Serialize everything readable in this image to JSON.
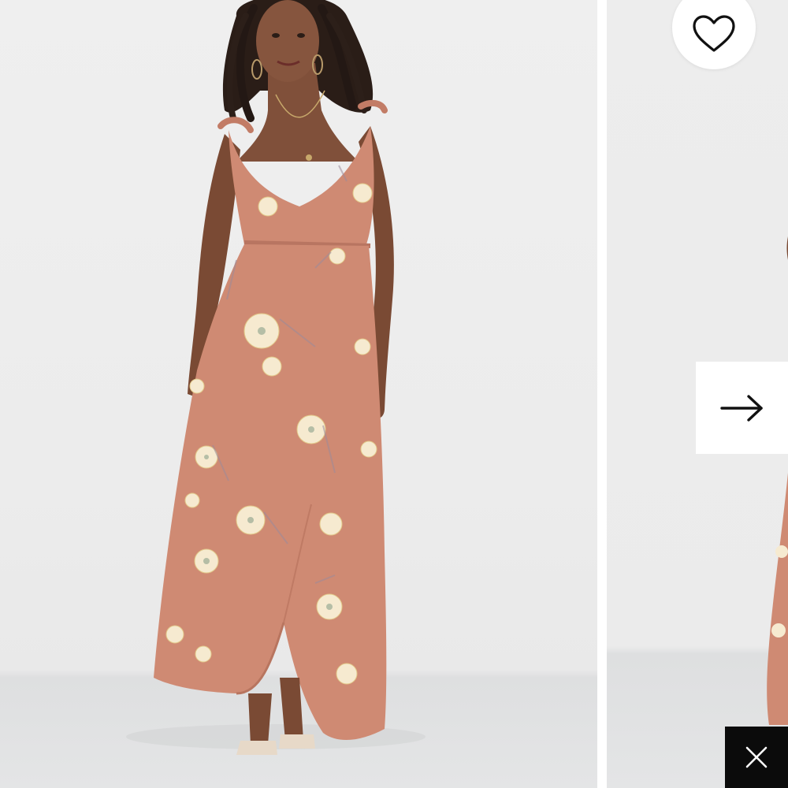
{
  "gallery": {
    "main_image": {
      "icon": "product-photo",
      "subject": "model-in-floral-wrap-maxi-dress"
    },
    "next_image": {
      "icon": "product-photo-partial"
    }
  },
  "controls": {
    "favorite": {
      "icon": "heart-outline-icon"
    },
    "next": {
      "icon": "arrow-right-icon"
    },
    "close": {
      "icon": "close-icon"
    }
  },
  "colors": {
    "dress": "#cf8a73",
    "backdrop": "#ececec",
    "floor": "#e3e4e5",
    "close_bg": "#0b0b0b",
    "button_bg": "#ffffff"
  }
}
